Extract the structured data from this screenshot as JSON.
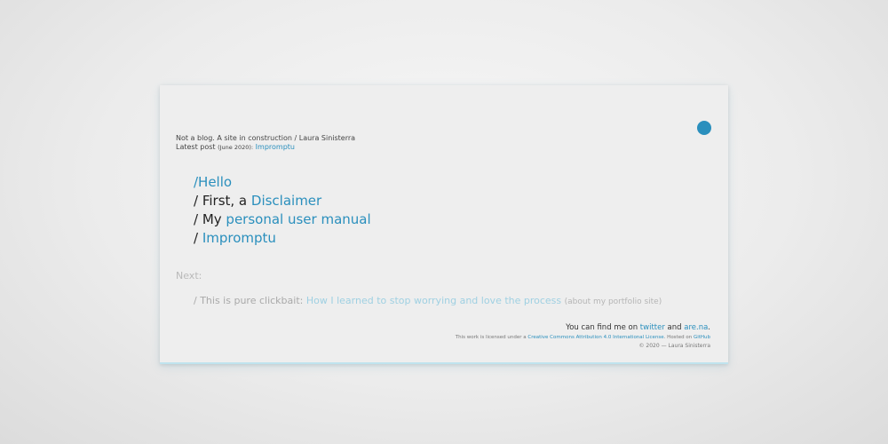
{
  "intro": {
    "tagline": "Not a blog. A site in construction / Laura Sinisterra",
    "latest_label": "Latest post",
    "latest_date": "(June 2020):",
    "latest_link": "Impromptu"
  },
  "nav": [
    {
      "prefix": "",
      "link": "/Hello"
    },
    {
      "prefix": "/ First, a ",
      "link": "Disclaimer"
    },
    {
      "prefix": "/ My ",
      "link": "personal user manual"
    },
    {
      "prefix": "/ ",
      "link": "Impromptu"
    }
  ],
  "next": {
    "label": "Next:",
    "prefix": "/ This is pure clickbait: ",
    "link": "How I learned to stop worrying and love the process",
    "note": "(about my portfolio site)"
  },
  "footer": {
    "find_prefix": "You can find me on ",
    "twitter": "twitter",
    "and": " and ",
    "arena": "are.na",
    "period": ".",
    "license_prefix": "This work is licensed under a ",
    "license_link": "Creative Commons Attribution 4.0 International License",
    "hosted": ". Hosted on ",
    "github": "GitHub",
    "copyright": "© 2020 — Laura Sinisterra"
  },
  "colors": {
    "accent": "#2a8fbd",
    "card_background": "#eeeeee"
  }
}
